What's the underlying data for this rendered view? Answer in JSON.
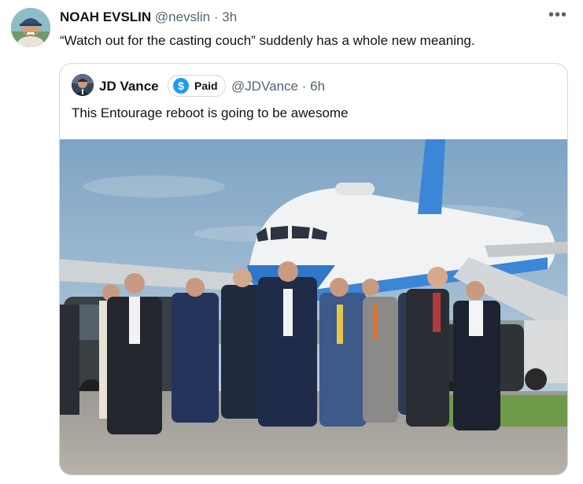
{
  "tweet": {
    "author_name": "NOAH EVSLIN",
    "handle": "@nevslin",
    "separator": "·",
    "time": "3h",
    "text": "“Watch out for the casting couch” suddenly has a whole new meaning.",
    "more_icon": "more-horizontal-icon",
    "more_label": "•••"
  },
  "quoted": {
    "author_name": "JD Vance",
    "badge_icon": "dollar-icon",
    "badge_icon_glyph": "$",
    "badge_label": "Paid",
    "handle": "@JDVance",
    "separator": "·",
    "time": "6h",
    "text": "This Entourage reboot is going to be awesome",
    "image": "photo of men in suits walking on tarmac away from a blue and white airplane"
  },
  "colors": {
    "text": "#0f1419",
    "secondary": "#536471",
    "border": "#cfd9de",
    "badge": "#1d9bf0"
  }
}
